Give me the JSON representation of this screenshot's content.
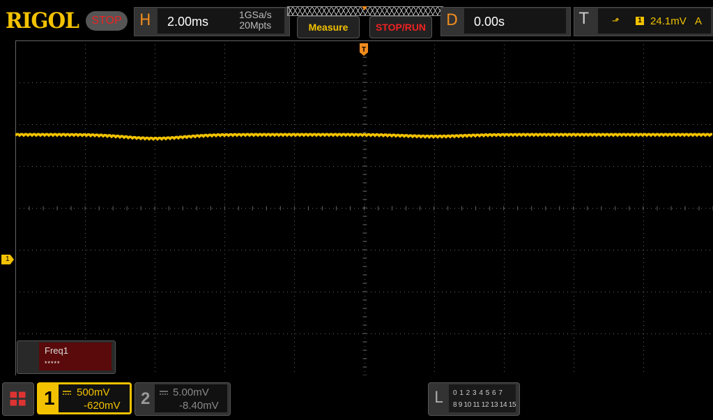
{
  "brand": {
    "logo": "RIGOL",
    "run_state": "STOP"
  },
  "horizontal": {
    "letter": "H",
    "timebase": "2.00ms",
    "sample_rate": "1GSa/s",
    "memory_depth": "20Mpts"
  },
  "buttons": {
    "measure": "Measure",
    "stop_run": "STOP/RUN"
  },
  "delay": {
    "letter": "D",
    "value": "0.00s"
  },
  "trigger": {
    "letter": "T",
    "source": "1",
    "level": "24.1mV",
    "mode": "A",
    "screen_marker": "T"
  },
  "ch1_marker": "1",
  "measurement": {
    "label": "Freq1",
    "value": "*****"
  },
  "channels": [
    {
      "number": "1",
      "scale": "500mV",
      "offset": "-620mV",
      "color": "#f2c200",
      "active": true
    },
    {
      "number": "2",
      "scale": "5.00mV",
      "offset": "-8.40mV",
      "color": "#888888",
      "active": false
    }
  ],
  "logic": {
    "letter": "L",
    "row1": "0 1 2 3  4 5 6 7",
    "row2": "8 9 10 11 12 13 14 15"
  },
  "colors": {
    "ch1": "#f2c200",
    "accent": "#f08c1e",
    "stop": "#e22222",
    "grid": "#666666"
  },
  "waveform": {
    "channel": "1",
    "level_divisions_above_center": 1.75,
    "features": [
      {
        "time_div": -3.0,
        "dip_div": 0.09
      },
      {
        "time_div": 1.0,
        "dip_div": 0.04
      }
    ]
  }
}
